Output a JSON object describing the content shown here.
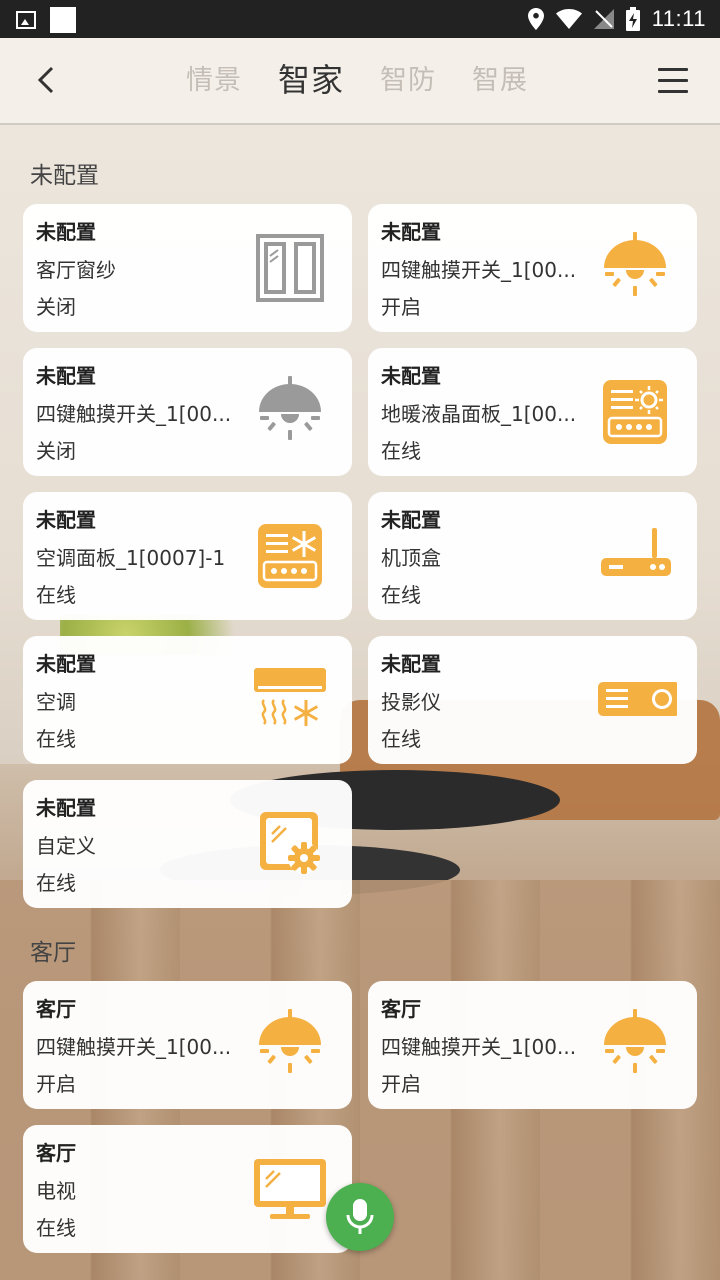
{
  "status_bar": {
    "time": "11:11"
  },
  "header": {
    "tabs": [
      {
        "label": "情景",
        "active": false
      },
      {
        "label": "智家",
        "active": true
      },
      {
        "label": "智防",
        "active": false
      },
      {
        "label": "智展",
        "active": false
      }
    ]
  },
  "sections": [
    {
      "title": "未配置",
      "devices": [
        {
          "room": "未配置",
          "name": "客厅窗纱",
          "status": "关闭",
          "icon": "curtain-icon"
        },
        {
          "room": "未配置",
          "name": "四键触摸开关_1[00...",
          "status": "开启",
          "icon": "lamp-on-icon"
        },
        {
          "room": "未配置",
          "name": "四键触摸开关_1[00...",
          "status": "关闭",
          "icon": "lamp-off-icon"
        },
        {
          "room": "未配置",
          "name": "地暖液晶面板_1[00...",
          "status": "在线",
          "icon": "floor-heating-panel-icon"
        },
        {
          "room": "未配置",
          "name": "空调面板_1[0007]-1",
          "status": "在线",
          "icon": "ac-panel-icon"
        },
        {
          "room": "未配置",
          "name": "机顶盒",
          "status": "在线",
          "icon": "set-top-box-icon"
        },
        {
          "room": "未配置",
          "name": "空调",
          "status": "在线",
          "icon": "air-conditioner-icon"
        },
        {
          "room": "未配置",
          "name": "投影仪",
          "status": "在线",
          "icon": "projector-icon"
        },
        {
          "room": "未配置",
          "name": "自定义",
          "status": "在线",
          "icon": "custom-device-icon"
        }
      ]
    },
    {
      "title": "客厅",
      "devices": [
        {
          "room": "客厅",
          "name": "四键触摸开关_1[00...",
          "status": "开启",
          "icon": "lamp-on-icon"
        },
        {
          "room": "客厅",
          "name": "四键触摸开关_1[00...",
          "status": "开启",
          "icon": "lamp-on-icon"
        },
        {
          "room": "客厅",
          "name": "电视",
          "status": "在线",
          "icon": "tv-icon"
        }
      ]
    }
  ],
  "colors": {
    "accent_orange": "#f5b042",
    "icon_gray": "#9a9a9a",
    "mic_green": "#4caf50"
  }
}
